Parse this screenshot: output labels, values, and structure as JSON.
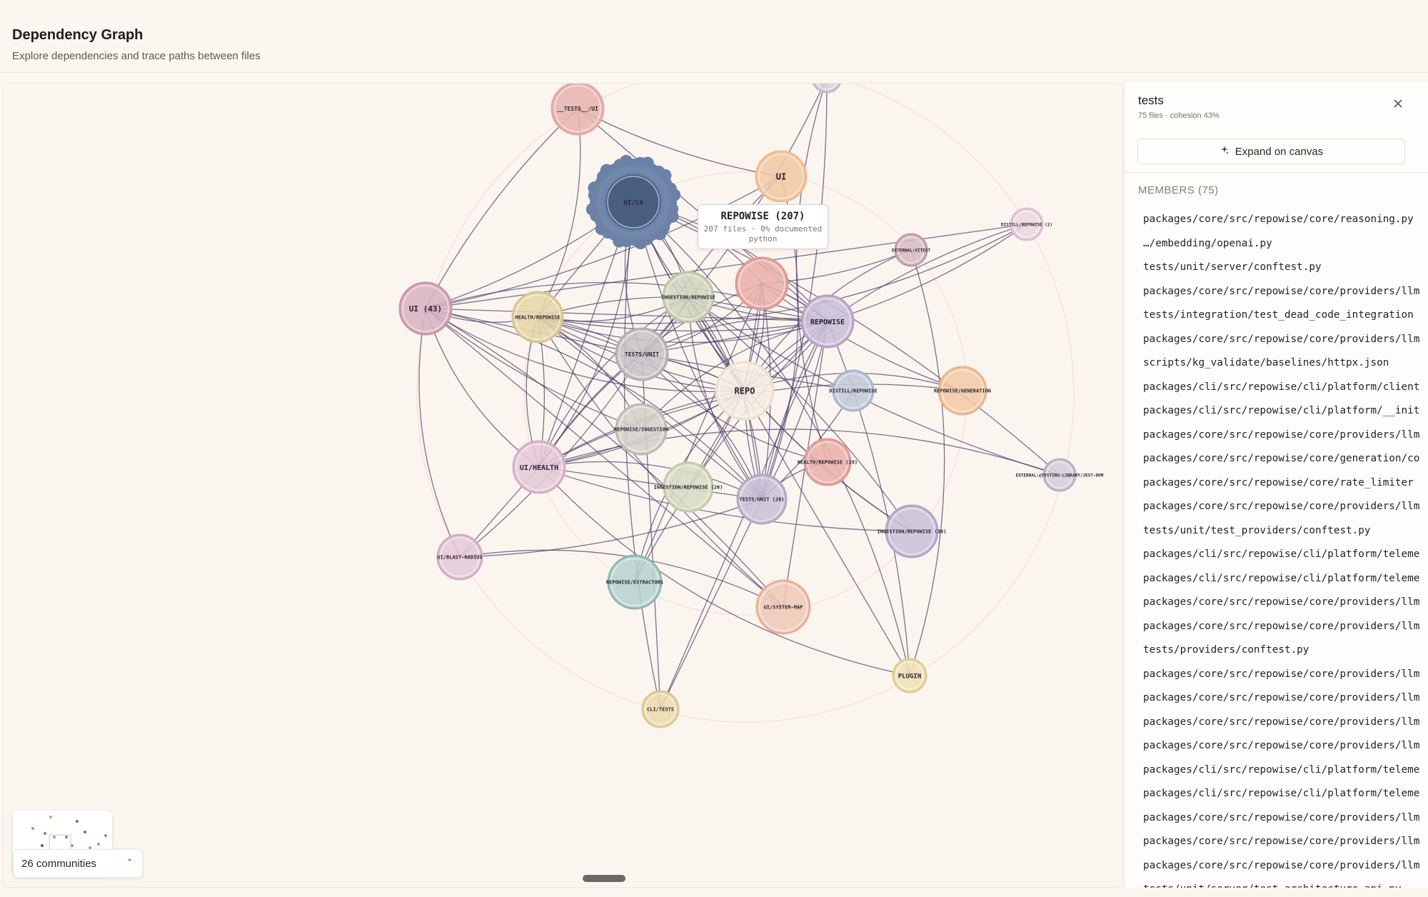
{
  "header": {
    "title": "Dependency Graph",
    "subtitle": "Explore dependencies and trace paths between files"
  },
  "graph": {
    "nodes": [
      {
        "id": "tests_ui",
        "label": "__TESTS__/UI",
        "color": "#e8b5b0",
        "ring": "#e7a7a2"
      },
      {
        "id": "ui_c4",
        "label": "UI/C4",
        "color": "#43587a",
        "ring": "#6a80a5"
      },
      {
        "id": "ui",
        "label": "UI",
        "color": "#f0c9a6",
        "ring": "#f4b98c"
      },
      {
        "id": "repowise_207",
        "label": "REPOWISE (207)",
        "color": "#eab1ad",
        "ring": "#e09790"
      },
      {
        "id": "ui_43",
        "label": "UI (43)",
        "color": "#d9b3c3",
        "ring": "#c897a8"
      },
      {
        "id": "health_repowise",
        "label": "HEALTH/REPOWISE",
        "color": "#e5d6a8",
        "ring": "#d9c58c"
      },
      {
        "id": "ingestion_repowise",
        "label": "INGESTION/REPOWISE",
        "color": "#d2d6bf",
        "ring": "#bfc6a6"
      },
      {
        "id": "tests_unit",
        "label": "TESTS/UNIT",
        "color": "#c9c4c8",
        "ring": "#b4aeb4"
      },
      {
        "id": "repowise",
        "label": "REPOWISE",
        "color": "#cbc0d8",
        "ring": "#b3a4c7"
      },
      {
        "id": "repo",
        "label": "REPO",
        "color": "#f7ece0",
        "ring": "#efe0cf"
      },
      {
        "id": "distill_repowise",
        "label": "DISTILL/REPOWISE",
        "color": "#c2cbd8",
        "ring": "#a9b8cc"
      },
      {
        "id": "repowise_generation",
        "label": "REPOWISE/GENERATION",
        "color": "#f2cba8",
        "ring": "#eab48b"
      },
      {
        "id": "repowise_ingestion",
        "label": "REPOWISE/INGESTION",
        "color": "#d5d0cb",
        "ring": "#bfb8b1"
      },
      {
        "id": "ui_health",
        "label": "UI/HEALTH",
        "color": "#e6c8d8",
        "ring": "#d6aec4"
      },
      {
        "id": "health_repowise_19",
        "label": "HEALTH/REPOWISE (19)",
        "color": "#eab1ad",
        "ring": "#df9a95"
      },
      {
        "id": "ingestion_repowise_26",
        "label": "INGESTION/REPOWISE (26)",
        "color": "#d7dcc4",
        "ring": "#c3cba8"
      },
      {
        "id": "tests_unit_26",
        "label": "TESTS/UNIT (26)",
        "color": "#cbc3d8",
        "ring": "#b4a8c6"
      },
      {
        "id": "ingestion_repowise_30",
        "label": "INGESTION/REPOWISE (30)",
        "color": "#cbc3d8",
        "ring": "#b2a6c6"
      },
      {
        "id": "ui_blast_radius",
        "label": "UI/BLAST-RADIUS",
        "color": "#e6c8d8",
        "ring": "#d2adc1"
      },
      {
        "id": "repowise_extractors",
        "label": "REPOWISE/EXTRACTORS",
        "color": "#b7d3cf",
        "ring": "#90b8b2"
      },
      {
        "id": "ui_system_map",
        "label": "UI/SYSTEM-MAP",
        "color": "#f0c8b8",
        "ring": "#e9ae98"
      },
      {
        "id": "plugin",
        "label": "PLUGIN",
        "color": "#efe1b5",
        "ring": "#e2cc8f"
      },
      {
        "id": "cli_tests",
        "label": "CLI/TESTS",
        "color": "#eadbb0",
        "ring": "#dcc78f"
      },
      {
        "id": "external_vitest",
        "label": "EXTERNAL:VITEST",
        "color": "#d8bcc6",
        "ring": "#c49aa8"
      },
      {
        "id": "distill_repowise_2",
        "label": "DISTILL/REPOWISE (2)",
        "color": "#ead8e2",
        "ring": "#dcbfcf"
      },
      {
        "id": "external_jest_dom",
        "label": "EXTERNAL:@TESTING-LIBRARY/JEST-DOM",
        "color": "#d4cfd8",
        "ring": "#b9b2c0"
      },
      {
        "id": "top_partial",
        "label": "",
        "color": "#d8d0dc",
        "ring": "#c3b8c9"
      }
    ],
    "edge_color": "#4a3f6a"
  },
  "tooltip": {
    "title": "REPOWISE (207)",
    "meta": "207 files · 0% documented",
    "language": "python"
  },
  "community_toggle": {
    "label": "26 communities",
    "icon": "chevron-up-icon"
  },
  "panel": {
    "title": "tests",
    "meta": "75 files · cohesion 43%",
    "expand_label": "Expand on canvas",
    "expand_icon": "sparkle-icon",
    "close_icon": "close-icon",
    "members_header": "MEMBERS (75)",
    "members": [
      "packages/core/src/repowise/core/reasoning.py",
      "…/embedding/openai.py",
      "tests/unit/server/conftest.py",
      "packages/core/src/repowise/core/providers/llm",
      "tests/integration/test_dead_code_integration",
      "packages/core/src/repowise/core/providers/llm",
      "scripts/kg_validate/baselines/httpx.json",
      "packages/cli/src/repowise/cli/platform/client",
      "packages/cli/src/repowise/cli/platform/__init",
      "packages/core/src/repowise/core/providers/llm",
      "packages/core/src/repowise/core/generation/co",
      "packages/core/src/repowise/core/rate_limiter",
      "packages/core/src/repowise/core/providers/llm",
      "tests/unit/test_providers/conftest.py",
      "packages/cli/src/repowise/cli/platform/teleme",
      "packages/cli/src/repowise/cli/platform/teleme",
      "packages/core/src/repowise/core/providers/llm",
      "packages/core/src/repowise/core/providers/llm",
      "tests/providers/conftest.py",
      "packages/core/src/repowise/core/providers/llm",
      "packages/core/src/repowise/core/providers/llm",
      "packages/core/src/repowise/core/providers/llm",
      "packages/core/src/repowise/core/providers/llm",
      "packages/cli/src/repowise/cli/platform/teleme",
      "packages/cli/src/repowise/cli/platform/teleme",
      "packages/core/src/repowise/core/providers/llm",
      "packages/core/src/repowise/core/providers/llm",
      "packages/core/src/repowise/core/providers/llm",
      "tests/unit/server/test_architecture_api.py"
    ]
  }
}
